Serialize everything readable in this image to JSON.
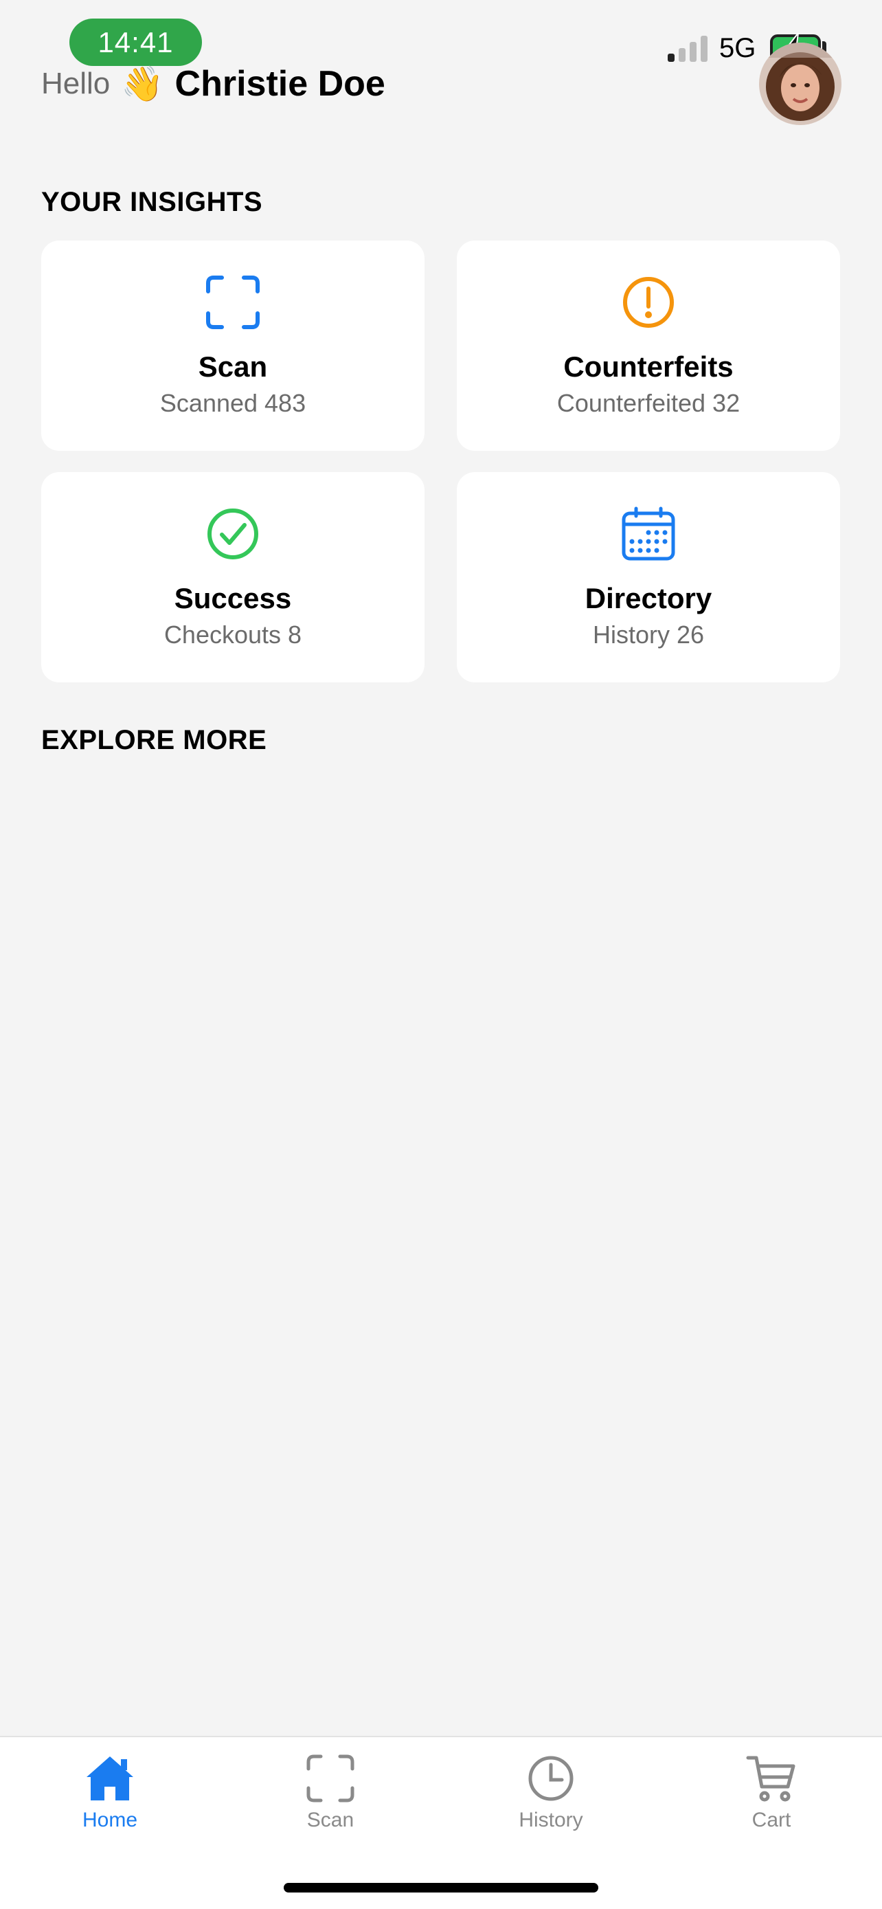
{
  "status_bar": {
    "time": "14:41",
    "network": "5G"
  },
  "header": {
    "hello": "Hello",
    "wave": "👋",
    "user_name": "Christie Doe"
  },
  "insights": {
    "title": "YOUR INSIGHTS",
    "cards": [
      {
        "icon": "scan-icon",
        "title": "Scan",
        "subtitle": "Scanned 483",
        "color": "#1a7cf0"
      },
      {
        "icon": "exclamation-circle-icon",
        "title": "Counterfeits",
        "subtitle": "Counterfeited 32",
        "color": "#f5940c"
      },
      {
        "icon": "checkmark-circle-icon",
        "title": "Success",
        "subtitle": "Checkouts 8",
        "color": "#34c759"
      },
      {
        "icon": "calendar-icon",
        "title": "Directory",
        "subtitle": "History 26",
        "color": "#1a7cf0"
      }
    ]
  },
  "explore": {
    "title": "EXPLORE MORE"
  },
  "tab_bar": {
    "active_color": "#1a7cf0",
    "inactive_color": "#8a8a8a",
    "tabs": [
      {
        "icon": "house-icon",
        "label": "Home",
        "active": true
      },
      {
        "icon": "scan-icon",
        "label": "Scan",
        "active": false
      },
      {
        "icon": "clock-icon",
        "label": "History",
        "active": false
      },
      {
        "icon": "cart-icon",
        "label": "Cart",
        "active": false
      }
    ]
  }
}
